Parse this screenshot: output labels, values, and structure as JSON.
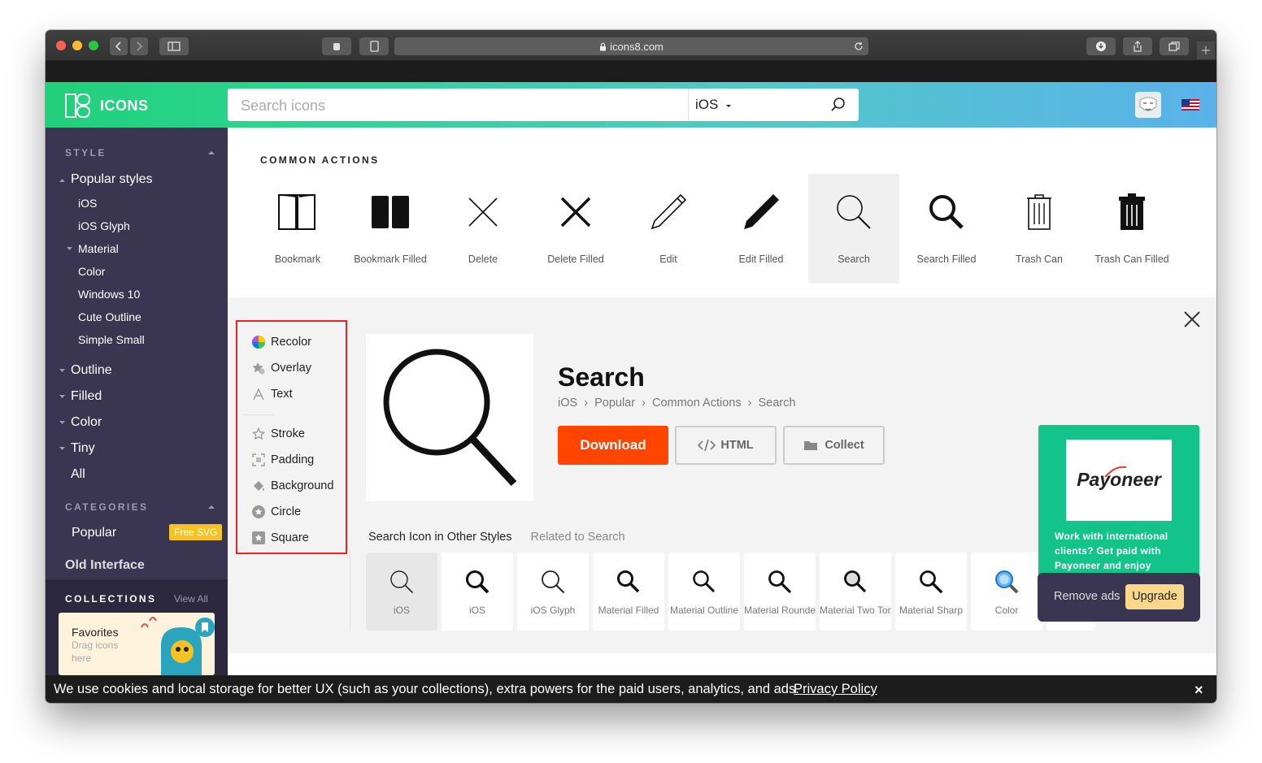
{
  "browser": {
    "url": "icons8.com",
    "back_icon": "chevron-left-icon",
    "forward_icon": "chevron-right-icon"
  },
  "header": {
    "logo_text": "ICONS",
    "search_placeholder": "Search icons",
    "style_select": "iOS",
    "brand_color": "#21d07a"
  },
  "sidebar": {
    "style_title": "STYLE",
    "popular_styles": "Popular styles",
    "items": [
      "iOS",
      "iOS Glyph",
      "Material",
      "Color",
      "Windows 10",
      "Cute Outline",
      "Simple Small"
    ],
    "groups": [
      "Outline",
      "Filled",
      "Color",
      "Tiny",
      "All"
    ],
    "categories_title": "CATEGORIES",
    "popular": "Popular",
    "free_svg_badge": "Free SVG",
    "old_interface": "Old Interface",
    "collections_title": "COLLECTIONS",
    "view_all": "View All",
    "favorites_title": "Favorites",
    "favorites_hint_1": "Drag icons",
    "favorites_hint_2": "here"
  },
  "common": {
    "title": "COMMON ACTIONS",
    "icons": [
      "Bookmark",
      "Bookmark Filled",
      "Delete",
      "Delete Filled",
      "Edit",
      "Edit Filled",
      "Search",
      "Search Filled",
      "Trash Can",
      "Trash Can Filled"
    ]
  },
  "tools": {
    "group1": [
      "Recolor",
      "Overlay",
      "Text"
    ],
    "group2": [
      "Stroke",
      "Padding",
      "Background",
      "Circle",
      "Square"
    ]
  },
  "detail": {
    "title": "Search",
    "crumb1": "iOS",
    "crumb2": "Popular",
    "crumb3": "Common Actions",
    "crumb4": "Search",
    "download": "Download",
    "html": "HTML",
    "collect": "Collect",
    "tab_other_styles": "Search Icon in Other Styles",
    "tab_related": "Related to Search",
    "styles": [
      "iOS",
      "iOS",
      "iOS Glyph",
      "Material Filled",
      "Material Outline",
      "Material Rounded",
      "Material Two Tone",
      "Material Sharp",
      "Color"
    ]
  },
  "ad": {
    "brand": "Payoneer",
    "text_1": "Work with international",
    "text_2": "clients? Get paid with",
    "text_3": "Payoneer and enjoy",
    "remove_ads": "Remove ads",
    "upgrade": "Upgrade"
  },
  "cookie": {
    "text": "We use cookies and local storage for better UX (such as your collections), extra powers for the paid users, analytics, and ads.",
    "link": "Privacy Policy",
    "close": "×"
  }
}
